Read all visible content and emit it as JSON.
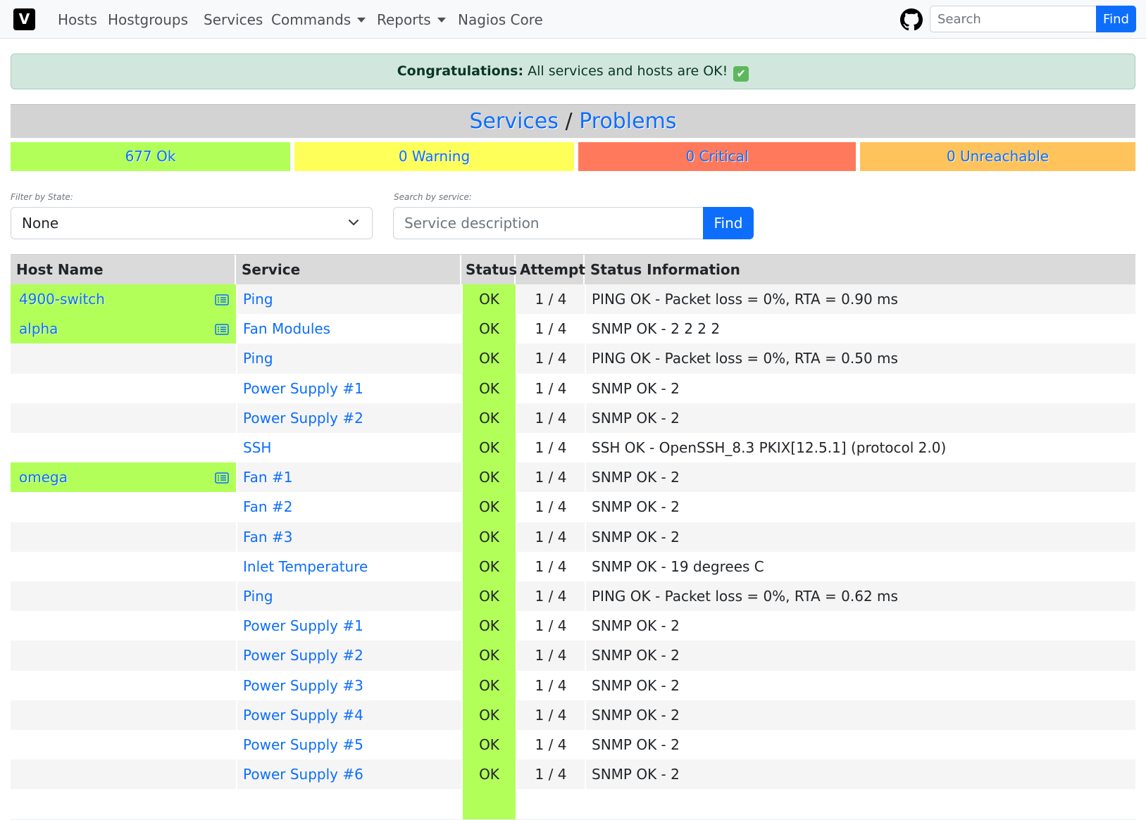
{
  "navbar": {
    "brand_letter": "V",
    "items": [
      {
        "label": "Hosts",
        "dropdown": false
      },
      {
        "label": "Hostgroups",
        "dropdown": false
      },
      {
        "label": "Services",
        "dropdown": false
      },
      {
        "label": "Commands",
        "dropdown": true
      },
      {
        "label": "Reports",
        "dropdown": true
      },
      {
        "label": "Nagios Core",
        "dropdown": false
      }
    ],
    "search_placeholder": "Search",
    "find_label": "Find",
    "github_icon": "github-icon"
  },
  "alert": {
    "strong": "Congratulations:",
    "message": " All services and hosts are OK!",
    "emoji": "✔"
  },
  "title": {
    "services": "Services",
    "separator": " / ",
    "problems": "Problems"
  },
  "summary": {
    "ok": {
      "label": "677 Ok",
      "color": "#b2ff59"
    },
    "warning": {
      "label": "0 Warning",
      "color": "#ffff59"
    },
    "critical": {
      "label": "0 Critical",
      "color": "#ff7a5c"
    },
    "unreachable": {
      "label": "0 Unreachable",
      "color": "#ffc35c"
    }
  },
  "filters": {
    "state_label": "Filter by State:",
    "state_value": "None",
    "service_label": "Search by service:",
    "service_placeholder": "Service description",
    "find_label": "Find"
  },
  "table": {
    "headers": [
      "Host Name",
      "Service",
      "Status",
      "Attempt",
      "Status Information"
    ],
    "rows": [
      {
        "host": "4900-switch",
        "service": "Ping",
        "status": "OK",
        "attempt": "1 / 4",
        "info": "PING OK - Packet loss = 0%, RTA = 0.90 ms"
      },
      {
        "host": "alpha",
        "service": "Fan Modules",
        "status": "OK",
        "attempt": "1 / 4",
        "info": "SNMP OK - 2 2 2 2"
      },
      {
        "host": "",
        "service": "Ping",
        "status": "OK",
        "attempt": "1 / 4",
        "info": "PING OK - Packet loss = 0%, RTA = 0.50 ms"
      },
      {
        "host": "",
        "service": "Power Supply #1",
        "status": "OK",
        "attempt": "1 / 4",
        "info": "SNMP OK - 2"
      },
      {
        "host": "",
        "service": "Power Supply #2",
        "status": "OK",
        "attempt": "1 / 4",
        "info": "SNMP OK - 2"
      },
      {
        "host": "",
        "service": "SSH",
        "status": "OK",
        "attempt": "1 / 4",
        "info": "SSH OK - OpenSSH_8.3 PKIX[12.5.1] (protocol 2.0)"
      },
      {
        "host": "omega",
        "service": "Fan #1",
        "status": "OK",
        "attempt": "1 / 4",
        "info": "SNMP OK - 2"
      },
      {
        "host": "",
        "service": "Fan #2",
        "status": "OK",
        "attempt": "1 / 4",
        "info": "SNMP OK - 2"
      },
      {
        "host": "",
        "service": "Fan #3",
        "status": "OK",
        "attempt": "1 / 4",
        "info": "SNMP OK - 2"
      },
      {
        "host": "",
        "service": "Inlet Temperature",
        "status": "OK",
        "attempt": "1 / 4",
        "info": "SNMP OK - 19 degrees C"
      },
      {
        "host": "",
        "service": "Ping",
        "status": "OK",
        "attempt": "1 / 4",
        "info": "PING OK - Packet loss = 0%, RTA = 0.62 ms"
      },
      {
        "host": "",
        "service": "Power Supply #1",
        "status": "OK",
        "attempt": "1 / 4",
        "info": "SNMP OK - 2"
      },
      {
        "host": "",
        "service": "Power Supply #2",
        "status": "OK",
        "attempt": "1 / 4",
        "info": "SNMP OK - 2"
      },
      {
        "host": "",
        "service": "Power Supply #3",
        "status": "OK",
        "attempt": "1 / 4",
        "info": "SNMP OK - 2"
      },
      {
        "host": "",
        "service": "Power Supply #4",
        "status": "OK",
        "attempt": "1 / 4",
        "info": "SNMP OK - 2"
      },
      {
        "host": "",
        "service": "Power Supply #5",
        "status": "OK",
        "attempt": "1 / 4",
        "info": "SNMP OK - 2"
      },
      {
        "host": "",
        "service": "Power Supply #6",
        "status": "OK",
        "attempt": "1 / 4",
        "info": "SNMP OK - 2"
      },
      {
        "host": "",
        "service": "",
        "status": "",
        "attempt": "",
        "info": ""
      }
    ]
  }
}
